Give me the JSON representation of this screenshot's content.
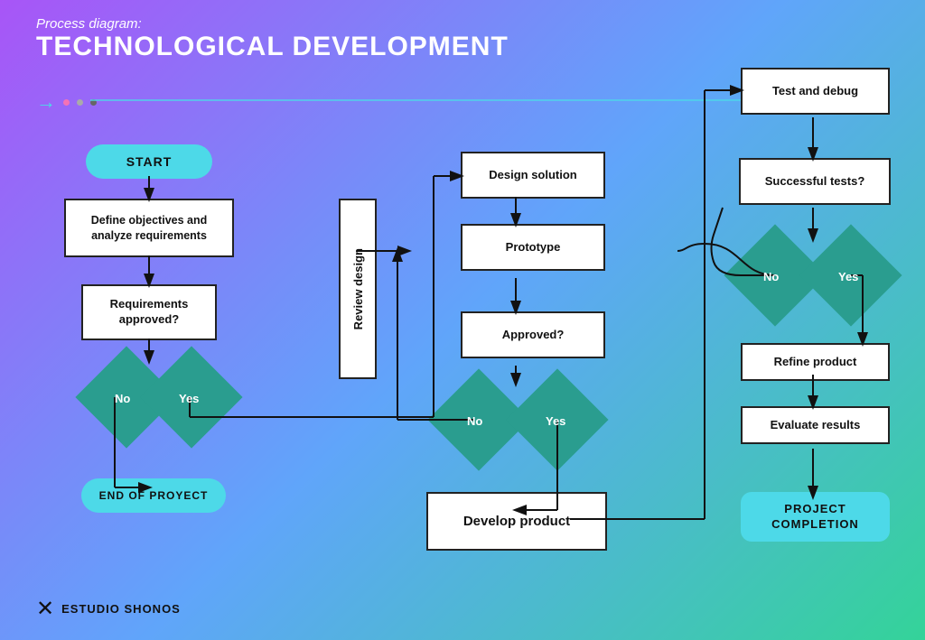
{
  "header": {
    "subtitle": "Process diagram:",
    "title": "TECHNOLOGICAL DEVELOPMENT"
  },
  "nodes": {
    "start": "START",
    "define": "Define objectives and\nanalyze requirements",
    "req_approved": "Requirements\napproved?",
    "no1": "No",
    "yes1": "Yes",
    "end_project": "END OF PROYECT",
    "design": "Design solution",
    "prototype": "Prototype",
    "approved": "Approved?",
    "no2": "No",
    "yes2": "Yes",
    "review": "Review design",
    "develop": "Develop product",
    "test": "Test and debug",
    "successful": "Successful tests?",
    "no3": "No",
    "yes3": "Yes",
    "refine": "Refine product",
    "evaluate": "Evaluate results",
    "completion": "PROJECT\nCOMPLETION"
  },
  "logo": {
    "text": "ESTUDIO SHONOS"
  },
  "colors": {
    "accent": "#4dd9e8",
    "diamond": "#2a9d8f",
    "white": "#fff",
    "black": "#111"
  }
}
